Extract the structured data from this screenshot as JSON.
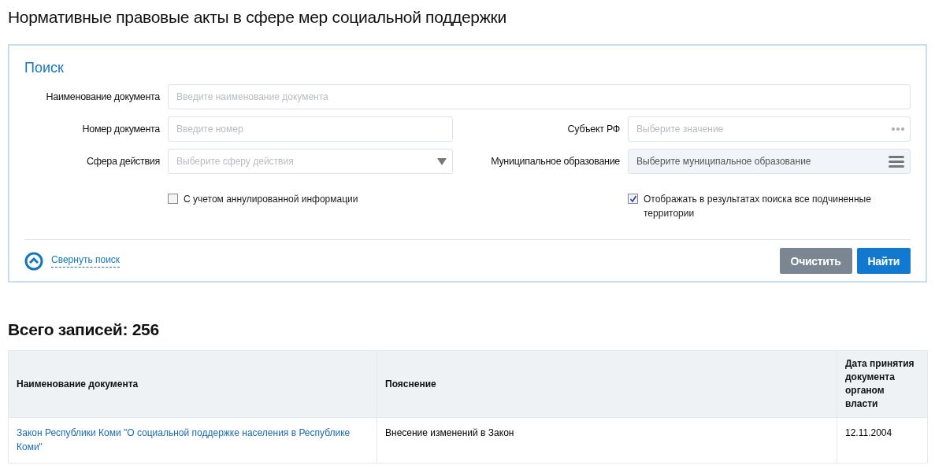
{
  "title": "Нормативные правовые акты в сфере мер социальной поддержки",
  "search": {
    "heading": "Поиск",
    "fields": [
      {
        "label": "Наименование документа",
        "placeholder": "Введите наименование документа",
        "kind": "text",
        "disabled": false
      },
      {
        "label": "Номер документа",
        "placeholder": "Введите номер",
        "kind": "text",
        "disabled": false
      },
      {
        "label": "Субъект РФ",
        "placeholder": "Выберите значение",
        "kind": "picker",
        "disabled": false
      },
      {
        "label": "Сфера действия",
        "placeholder": "Выберите сферу действия",
        "kind": "select",
        "disabled": false
      },
      {
        "label": "Муниципальное образование",
        "placeholder": "Выберите муниципальное образование",
        "kind": "list",
        "disabled": true
      }
    ],
    "checkboxes": [
      {
        "label": "С учетом аннулированной информации",
        "checked": false
      },
      {
        "label": "Отображать в результатах поиска все подчиненные территории",
        "checked": true
      }
    ],
    "collapse_link": "Свернуть поиск",
    "buttons": [
      {
        "label": "Очистить",
        "kind": "secondary"
      },
      {
        "label": "Найти",
        "kind": "primary"
      }
    ]
  },
  "total": "Всего записей: 256",
  "table": {
    "columns": [
      "Наименование документа",
      "Пояснение",
      "Дата принятия документа органом власти"
    ],
    "rows": [
      {
        "cells": [
          "Закон Республики Коми \"О социальной поддержке населения в Республике Коми\"",
          "Внесение изменений в Закон",
          "12.11.2004"
        ]
      }
    ]
  }
}
